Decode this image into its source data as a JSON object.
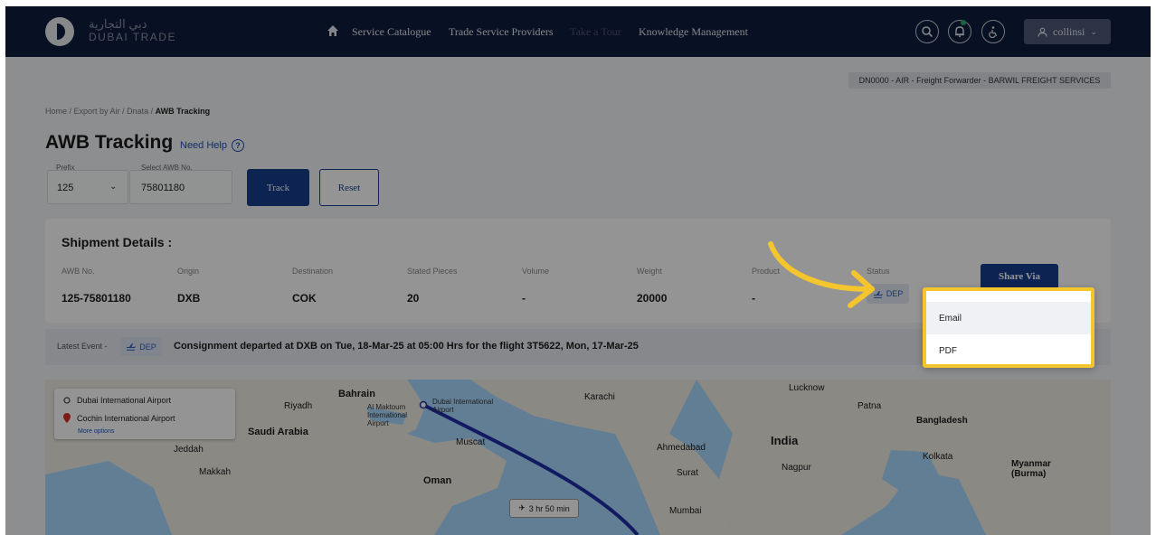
{
  "brand": {
    "name_ar": "دبي التجارية",
    "name_en": "DUBAI TRADE"
  },
  "nav": {
    "links": [
      "Service Catalogue",
      "Trade Service Providers",
      "Take a Tour",
      "Knowledge Management"
    ],
    "user": "collinsi"
  },
  "company_tag": "DN0000 - AIR - Freight Forwarder - BARWIL FREIGHT SERVICES",
  "breadcrumb": {
    "items": [
      "Home",
      "Export by Air",
      "Dnata"
    ],
    "current": "AWB Tracking"
  },
  "page": {
    "title": "AWB Tracking",
    "help_label": "Need Help"
  },
  "form": {
    "prefix_label": "Prefix",
    "prefix_value": "125",
    "awb_label": "Select AWB No.",
    "awb_value": "75801180",
    "track_label": "Track",
    "reset_label": "Reset"
  },
  "shipment": {
    "heading": "Shipment Details :",
    "columns": [
      "AWB No.",
      "Origin",
      "Destination",
      "Stated Pieces",
      "Volume",
      "Weight",
      "Product",
      "Status"
    ],
    "values": [
      "125-75801180",
      "DXB",
      "COK",
      "20",
      "-",
      "20000",
      "-"
    ],
    "status": "DEP",
    "share_label": "Share Via"
  },
  "latest_event": {
    "label": "Latest Event -",
    "status": "DEP",
    "text": "Consignment departed at DXB on Tue, 18-Mar-25 at 05:00 Hrs for the flight 3T5622, Mon, 17-Mar-25"
  },
  "map": {
    "origin": "Dubai International Airport",
    "destination": "Cochin International Airport",
    "more_options": "More options",
    "flight_time": "3 hr 50 min",
    "labels": [
      "Riyadh",
      "Bahrain",
      "Saudi Arabia",
      "Jeddah",
      "Makkah",
      "Oman",
      "Muscat",
      "Karachi",
      "India",
      "Ahmedabad",
      "Surat",
      "Mumbai",
      "Nagpur",
      "Lucknow",
      "Patna",
      "Bangladesh",
      "Kolkata",
      "Myanmar (Burma)",
      "Al Maktoum International Airport",
      "Dubai International Airport"
    ]
  },
  "share_menu": {
    "items": [
      "Email",
      "PDF"
    ]
  }
}
